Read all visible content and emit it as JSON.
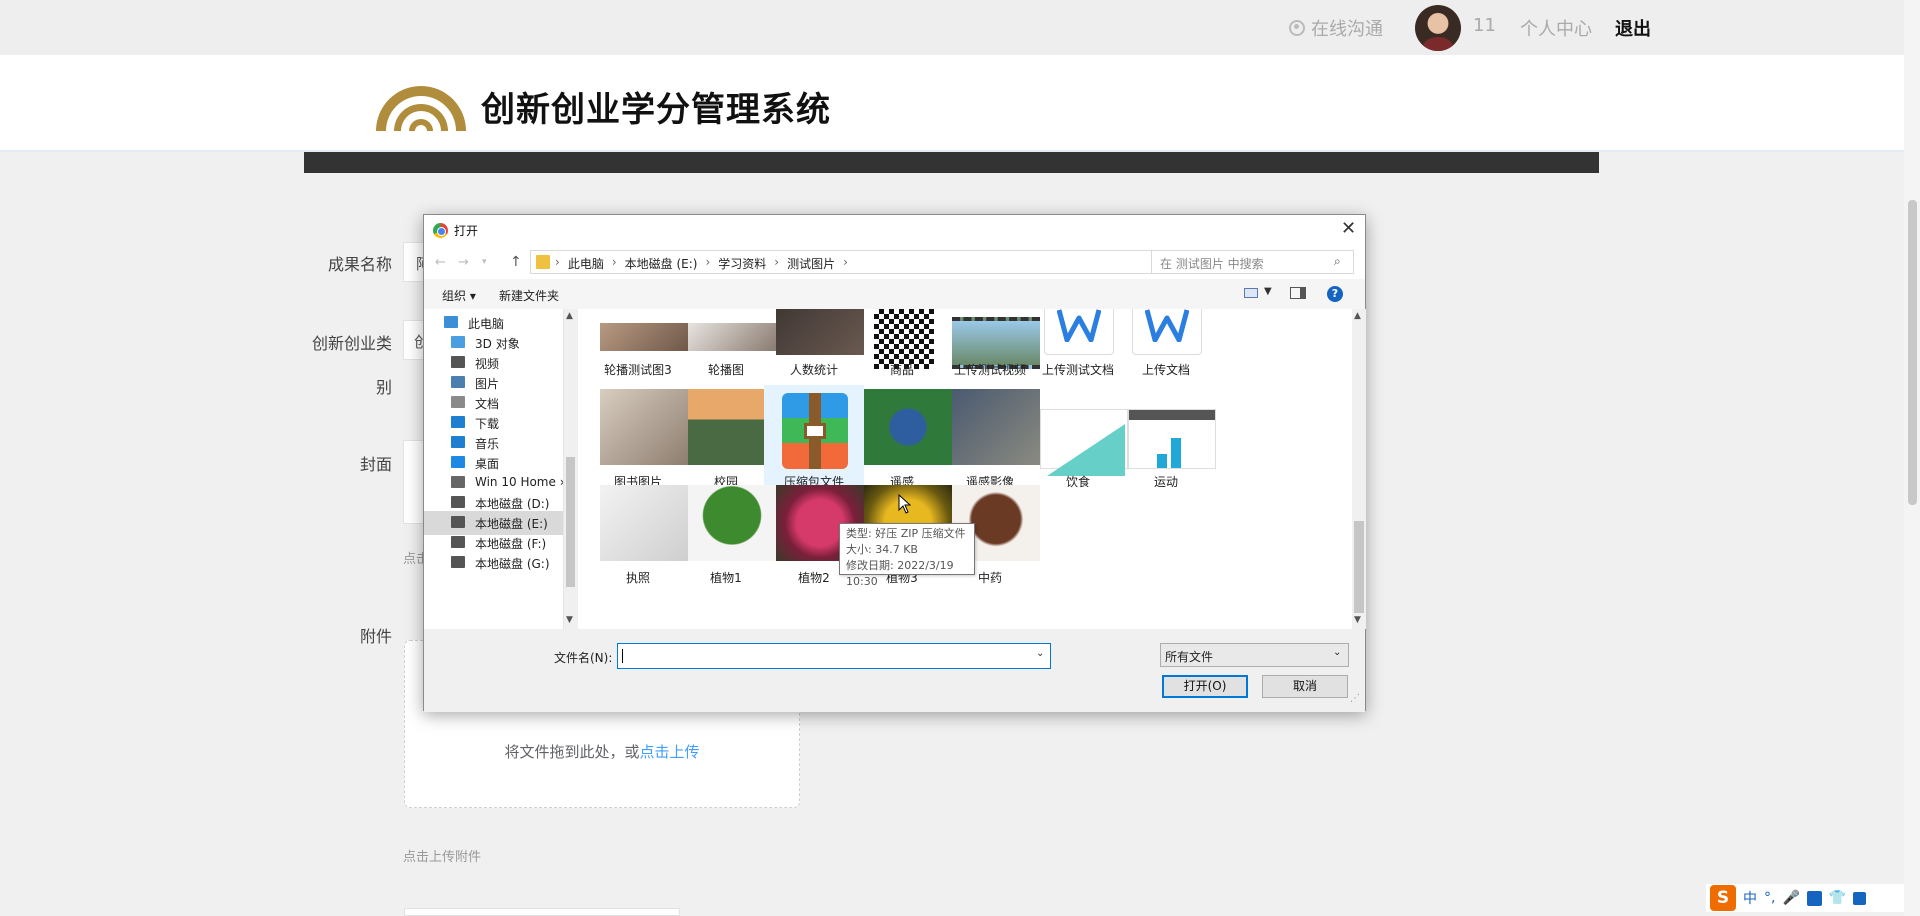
{
  "topbar": {
    "chat": "在线沟通",
    "count": "11",
    "personal_center": "个人中心",
    "logout": "退出"
  },
  "header": {
    "title": "创新创业学分管理系统",
    "logo_color": "#b08d3c"
  },
  "form": {
    "name_label": "成果名称",
    "category_label_1": "创新创业类",
    "category_label_2": "别",
    "cover_label": "封面",
    "attachment_label": "附件",
    "name_value_peek": "阿",
    "category_value_peek": "创",
    "cover_hint_peek": "点击",
    "drop_text": "将文件拖到此处，或",
    "drop_link": "点击上传",
    "attach_hint": "点击上传附件"
  },
  "dialog": {
    "title": "打开",
    "breadcrumbs": [
      "此电脑",
      "本地磁盘 (E:)",
      "学习资料",
      "测试图片"
    ],
    "search_placeholder": "在 测试图片 中搜索",
    "organize": "组织 ▾",
    "new_folder": "新建文件夹",
    "help": "?",
    "nav": [
      {
        "label": "此电脑",
        "color": "#3c8fd6"
      },
      {
        "label": "3D 对象",
        "color": "#4a9fe0"
      },
      {
        "label": "视频",
        "color": "#555555"
      },
      {
        "label": "图片",
        "color": "#4a7fb0"
      },
      {
        "label": "文档",
        "color": "#8a8a8a"
      },
      {
        "label": "下载",
        "color": "#1e7fd0"
      },
      {
        "label": "音乐",
        "color": "#1e7fd0"
      },
      {
        "label": "桌面",
        "color": "#1e88e5"
      },
      {
        "label": "Win 10 Home ›",
        "color": "#666666"
      },
      {
        "label": "本地磁盘 (D:)",
        "color": "#555555"
      },
      {
        "label": "本地磁盘 (E:)",
        "color": "#555555"
      },
      {
        "label": "本地磁盘 (F:)",
        "color": "#555555"
      },
      {
        "label": "本地磁盘 (G:)",
        "color": "#555555"
      }
    ],
    "files": [
      {
        "label": "轮播测试图3",
        "icon": "photo-thumb"
      },
      {
        "label": "轮播图",
        "icon": "photo-thumb"
      },
      {
        "label": "人数统计",
        "icon": "photo-thumb"
      },
      {
        "label": "商品",
        "icon": "qr-code-thumb"
      },
      {
        "label": "上传测试视频",
        "icon": "video-thumb"
      },
      {
        "label": "上传测试文档",
        "icon": "word-doc-icon"
      },
      {
        "label": "上传文档",
        "icon": "word-doc-icon"
      },
      {
        "label": "图书图片",
        "icon": "photo-thumb"
      },
      {
        "label": "校园",
        "icon": "photo-thumb"
      },
      {
        "label": "压缩包文件",
        "icon": "zip-archive-icon"
      },
      {
        "label": "遥感",
        "icon": "photo-thumb"
      },
      {
        "label": "遥感影像",
        "icon": "photo-thumb"
      },
      {
        "label": "饮食",
        "icon": "chart-thumb"
      },
      {
        "label": "运动",
        "icon": "chart-thumb"
      },
      {
        "label": "执照",
        "icon": "photo-thumb"
      },
      {
        "label": "植物1",
        "icon": "photo-thumb"
      },
      {
        "label": "植物2",
        "icon": "photo-thumb"
      },
      {
        "label": "植物3",
        "icon": "photo-thumb"
      },
      {
        "label": "中药",
        "icon": "photo-thumb"
      }
    ],
    "tooltip": {
      "type": "类型: 好压 ZIP 压缩文件",
      "size": "大小: 34.7 KB",
      "date": "修改日期: 2022/3/19 10:30"
    },
    "filename_label": "文件名(N):",
    "filename_value": "",
    "filetype": "所有文件",
    "open_button": "打开(O)",
    "cancel_button": "取消"
  },
  "ime": {
    "lang": "中",
    "punct": "°,"
  }
}
